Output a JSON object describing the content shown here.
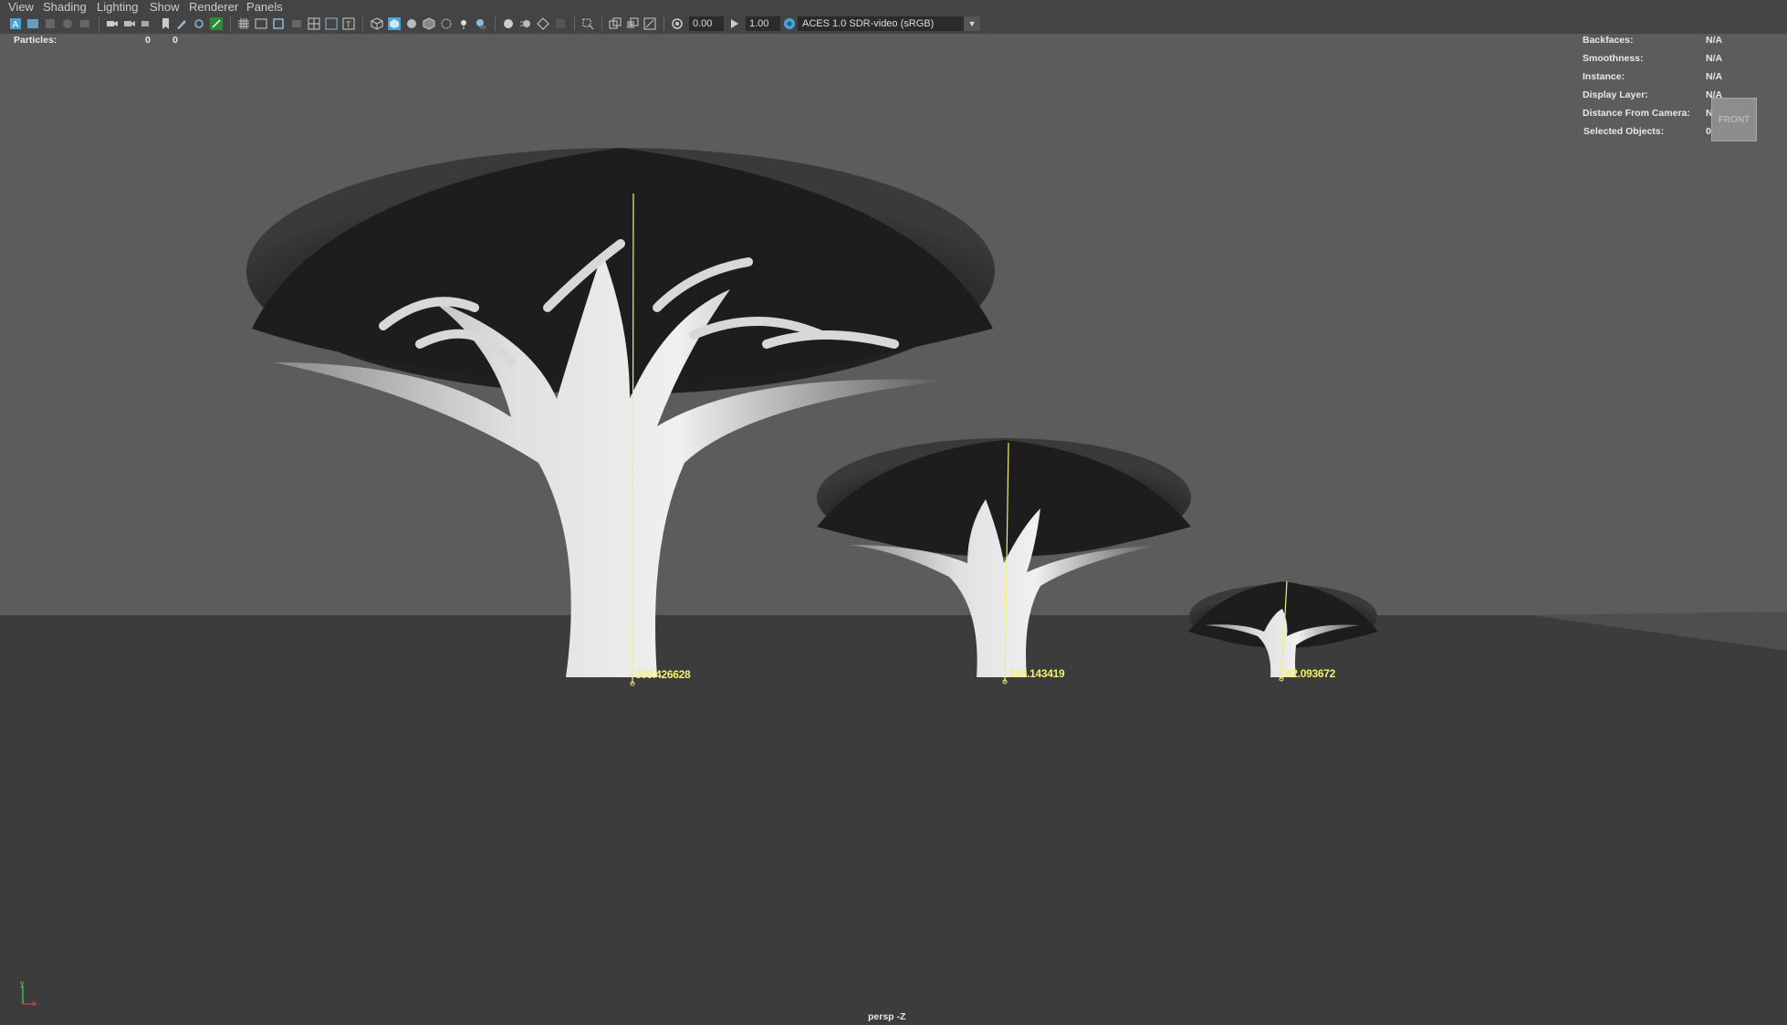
{
  "menu": [
    "View",
    "Shading",
    "Lighting",
    "Show",
    "Renderer",
    "Panels"
  ],
  "toolbar": {
    "exposure": "0.00",
    "gamma": "1.00",
    "color_space": "ACES 1.0 SDR-video (sRGB)",
    "dropdown_icon": "chevron-down-icon"
  },
  "hud_left": {
    "particles_label": "Particles:",
    "particles_v1": "0",
    "particles_v2": "0"
  },
  "hud_right": [
    {
      "label": "Backfaces:",
      "value": "N/A"
    },
    {
      "label": "Smoothness:",
      "value": "N/A"
    },
    {
      "label": "Instance:",
      "value": "N/A"
    },
    {
      "label": "Display Layer:",
      "value": "N/A"
    },
    {
      "label": "Distance From Camera:",
      "value": "N/A"
    },
    {
      "label": "Selected Objects:",
      "value": "0"
    }
  ],
  "viewcube_label": "FRONT",
  "measurements": [
    "309.426628",
    "165.143419",
    "82.093672"
  ],
  "camera_label": "persp -Z",
  "colors": {
    "measure": "#f2f26a",
    "background_wall": "#5c5c5c",
    "ground": "#3c3c3c",
    "accent": "#4aa3d6"
  }
}
